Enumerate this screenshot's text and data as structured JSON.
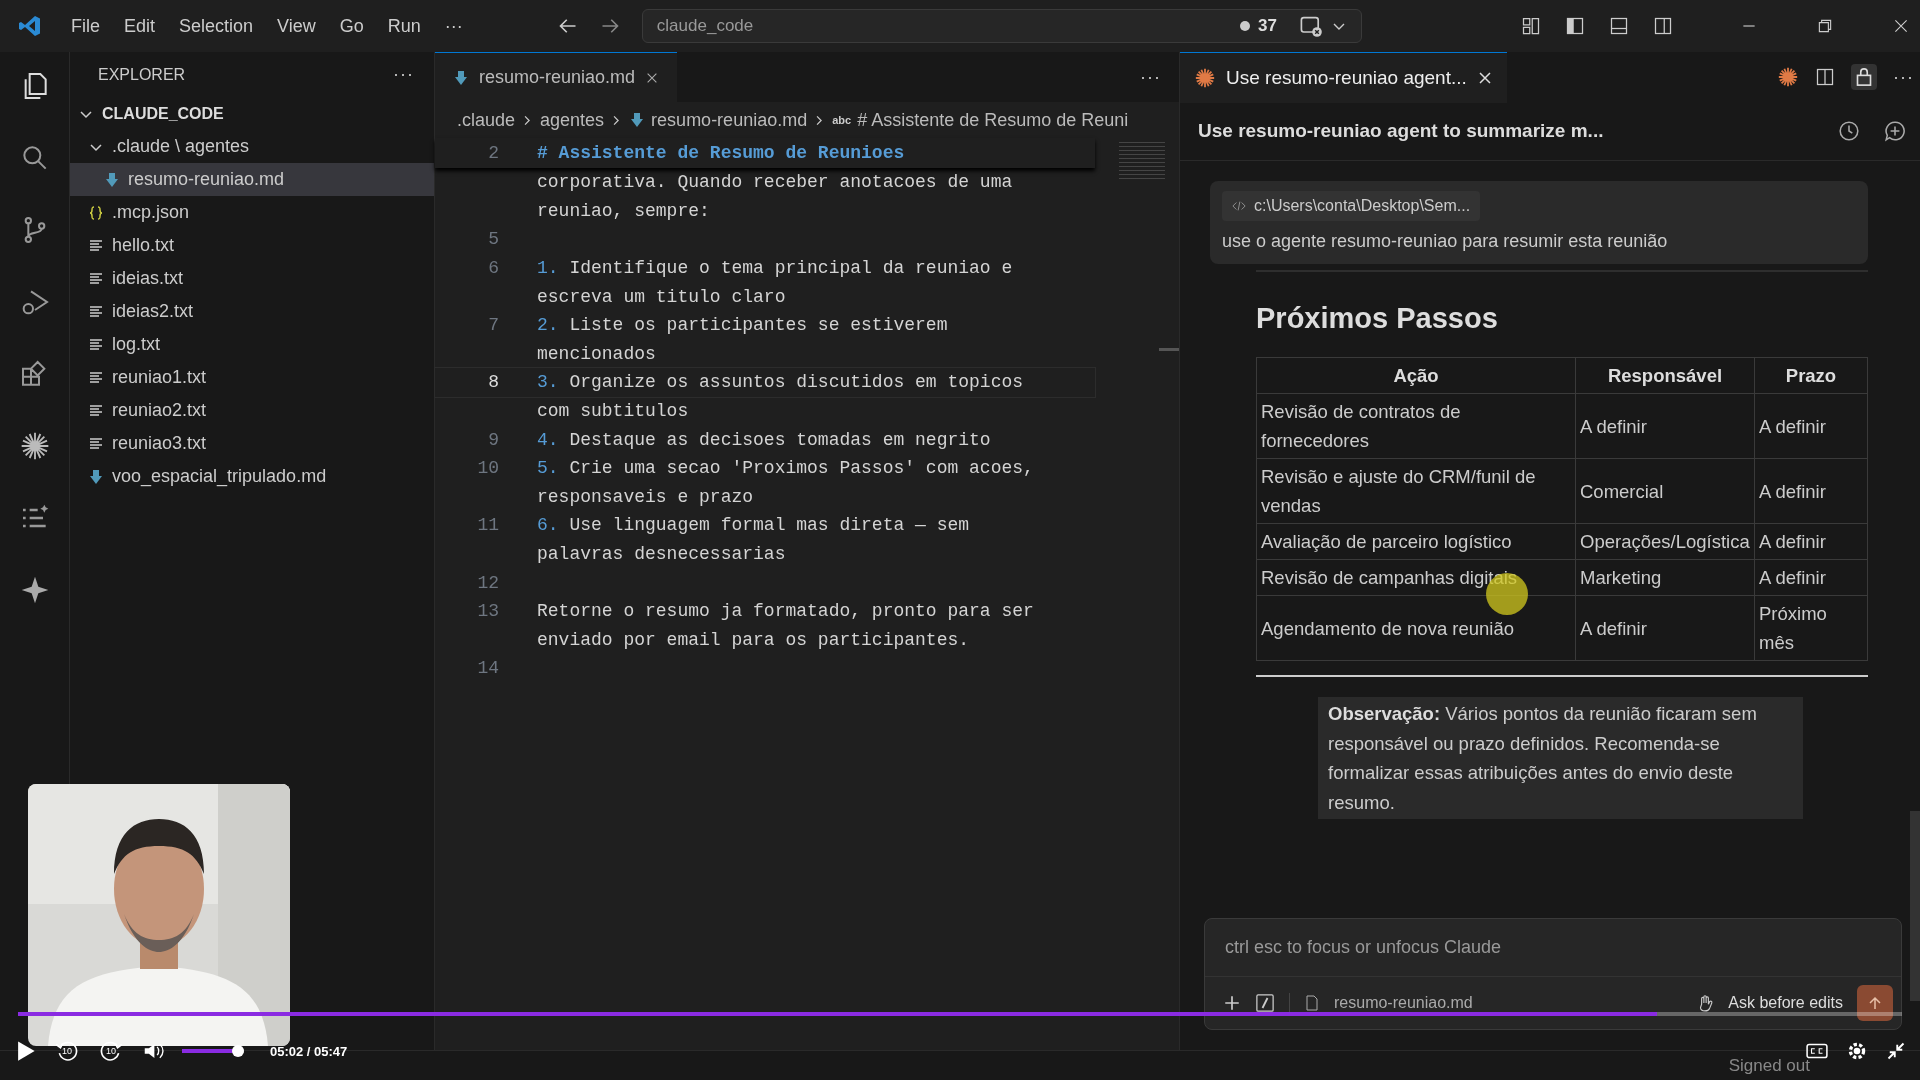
{
  "title_bar": {
    "menu": [
      "File",
      "Edit",
      "Selection",
      "View",
      "Go",
      "Run",
      "···"
    ],
    "search": "claude_code",
    "badge_count": "37"
  },
  "explorer": {
    "title": "EXPLORER",
    "more": "···",
    "root": {
      "label": "CLAUDE_CODE",
      "expanded": true,
      "children": [
        {
          "label": ".claude \\ agentes",
          "kind": "folder",
          "expanded": true,
          "selected": false,
          "children": [
            {
              "label": "resumo-reuniao.md",
              "kind": "md",
              "selected": true
            }
          ]
        },
        {
          "label": ".mcp.json",
          "kind": "json",
          "selected": false
        },
        {
          "label": "hello.txt",
          "kind": "txt",
          "selected": false
        },
        {
          "label": "ideias.txt",
          "kind": "txt",
          "selected": false
        },
        {
          "label": "ideias2.txt",
          "kind": "txt",
          "selected": false
        },
        {
          "label": "log.txt",
          "kind": "txt",
          "selected": false
        },
        {
          "label": "reuniao1.txt",
          "kind": "txt",
          "selected": false
        },
        {
          "label": "reuniao2.txt",
          "kind": "txt",
          "selected": false
        },
        {
          "label": "reuniao3.txt",
          "kind": "txt",
          "selected": false
        },
        {
          "label": "voo_espacial_tripulado.md",
          "kind": "md",
          "selected": false
        }
      ]
    }
  },
  "editor": {
    "tab": "resumo-reuniao.md",
    "more": "···",
    "breadcrumb": [
      {
        "label": ".claude",
        "kind": "folder"
      },
      {
        "label": "agentes",
        "kind": "folder"
      },
      {
        "label": "resumo-reuniao.md",
        "kind": "file"
      },
      {
        "label": "# Assistente de Resumo de Reuni",
        "kind": "symbol",
        "prefix": "abc"
      }
    ],
    "sticky": {
      "num": "2",
      "text": "# Assistente de Resumo de Reunioes"
    },
    "lines": [
      {
        "text": "corporativa. Quando receber anotacoes de uma"
      },
      {
        "text": "reuniao, sempre:"
      },
      {
        "num": "5",
        "current": false
      },
      {
        "num": "6",
        "current": false,
        "marker": "1.",
        "text": "Identifique o tema principal da reuniao e"
      },
      {
        "text": "escreva um titulo claro"
      },
      {
        "num": "7",
        "current": false,
        "marker": "2.",
        "text": "Liste os participantes se estiverem"
      },
      {
        "text": "mencionados"
      },
      {
        "num": "8",
        "current": true,
        "marker": "3.",
        "text": "Organize os assuntos discutidos em topicos"
      },
      {
        "text": "com subtitulos"
      },
      {
        "num": "9",
        "current": false,
        "marker": "4.",
        "text": "Destaque as decisoes tomadas em negrito"
      },
      {
        "num": "10",
        "current": false,
        "marker": "5.",
        "text": "Crie uma secao 'Proximos Passos' com acoes,"
      },
      {
        "text": "responsaveis e prazo"
      },
      {
        "num": "11",
        "current": false,
        "marker": "6.",
        "text": "Use linguagem formal mas direta — sem"
      },
      {
        "text": "palavras desnecessarias"
      },
      {
        "num": "12",
        "current": false
      },
      {
        "num": "13",
        "current": false,
        "text": "Retorne o resumo ja formatado, pronto para ser"
      },
      {
        "text": "enviado por email para os participantes."
      },
      {
        "num": "14",
        "current": false
      }
    ]
  },
  "chat": {
    "tab": "Use resumo-reuniao agent...",
    "more": "···",
    "header": "Use resumo-reuniao agent to summarize m...",
    "user_message": {
      "attachment": "c:\\Users\\conta\\Desktop\\Sem...",
      "text": "use o agente resumo-reuniao para resumir esta reunião"
    },
    "heading": "Próximos Passos",
    "table": {
      "columns": [
        "Ação",
        "Responsável",
        "Prazo"
      ],
      "rows": [
        [
          "Revisão de contratos de fornecedores",
          "A definir",
          "A definir"
        ],
        [
          "Revisão e ajuste do CRM/funil de vendas",
          "Comercial",
          "A definir"
        ],
        [
          "Avaliação de parceiro logístico",
          "Operações/Logística",
          "A definir"
        ],
        [
          "Revisão de campanhas digitais",
          "Marketing",
          "A definir"
        ],
        [
          "Agendamento de nova reunião",
          "A definir",
          "Próximo mês"
        ]
      ]
    },
    "note": "**Observação:** Vários pontos da reunião ficaram sem responsável ou prazo definidos. Recomenda-se formalizar essas atribuições antes do envio deste resumo.",
    "input": {
      "placeholder": "ctrl esc to focus or unfocus Claude",
      "file": "resumo-reuniao.md",
      "mode": "Ask before edits"
    }
  },
  "status_bar": {
    "account": "Signed out"
  },
  "video_player": {
    "progress": {
      "level": 0.87
    },
    "volume": {
      "level": 0.9
    },
    "skip_back": "10",
    "skip_forward": "10",
    "time": "05:02 / 05:47"
  }
}
